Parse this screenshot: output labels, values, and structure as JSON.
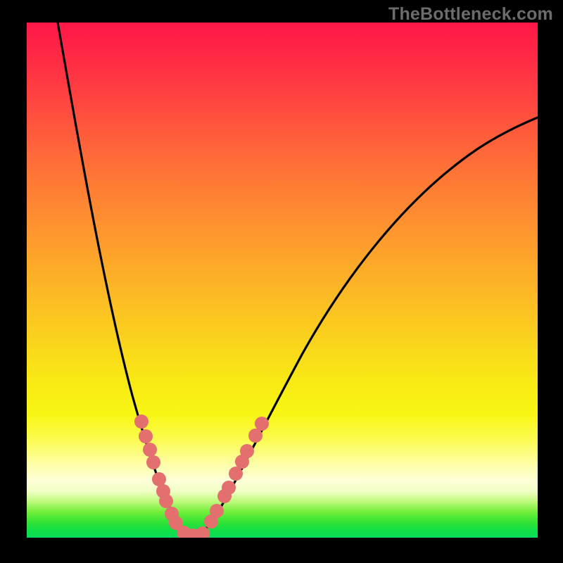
{
  "watermark": "TheBottleneck.com",
  "colors": {
    "frame": "#000000",
    "curve": "#000000",
    "marker": "#e36f6e",
    "gradient_top": "#ff1748",
    "gradient_bottom": "#08dd5a"
  },
  "chart_data": {
    "type": "line",
    "title": "",
    "xlabel": "",
    "ylabel": "",
    "xlim": [
      0,
      100
    ],
    "ylim": [
      0,
      100
    ],
    "note": "Axes are unlabeled in the source image; x and y are normalized 0–100 with y=0 at bottom. The background heat-map encodes severity (red high, green low).",
    "series": [
      {
        "name": "bottleneck-curve",
        "description": "V-shaped curve; steep descent on left, minimum near x≈32, gentler logarithmic ascent on right.",
        "x": [
          6,
          10,
          14,
          18,
          21,
          24,
          27,
          29,
          31,
          32.5,
          34,
          36,
          39,
          43,
          48,
          55,
          65,
          78,
          90,
          100
        ],
        "y": [
          100,
          78,
          56,
          40,
          28,
          18,
          10,
          5,
          1,
          0,
          1,
          4,
          10,
          18,
          28,
          40,
          55,
          70,
          79,
          82
        ]
      }
    ],
    "markers": {
      "name": "highlighted-data-points",
      "color": "#e36f6e",
      "x": [
        22.4,
        23.3,
        24.1,
        24.8,
        25.9,
        26.7,
        27.3,
        28.4,
        29.2,
        30.7,
        32.5,
        34.4,
        36.1,
        37.2,
        38.7,
        39.5,
        40.9,
        42.1,
        43.1,
        44.8,
        46.0
      ],
      "y": [
        22.5,
        19.7,
        17.1,
        14.6,
        11.3,
        9.0,
        7.1,
        4.6,
        2.9,
        1.0,
        0.4,
        0.8,
        3.1,
        5.2,
        8.1,
        9.7,
        12.4,
        14.8,
        16.8,
        19.8,
        22.1
      ]
    }
  }
}
